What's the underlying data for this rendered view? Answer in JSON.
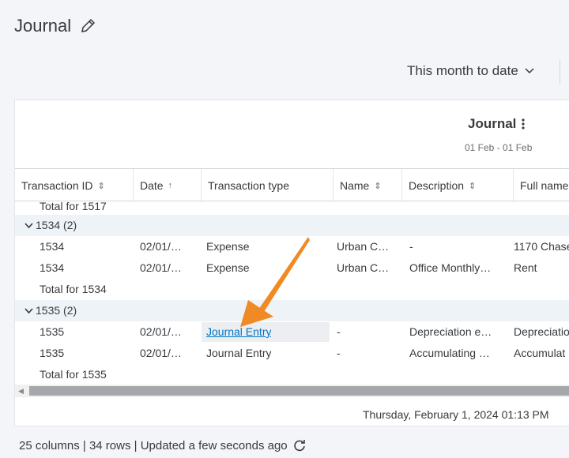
{
  "page": {
    "title": "Journal"
  },
  "filter": {
    "date_range": "This month to date"
  },
  "report": {
    "title": "Journal",
    "range": "01 Feb - 01 Feb",
    "columns": [
      "Transaction ID",
      "Date",
      "Transaction type",
      "Name",
      "Description",
      "Full name"
    ],
    "sort_icons": [
      "⇕",
      "↑",
      "",
      "⇕",
      "⇕",
      ""
    ],
    "rows": [
      {
        "kind": "total",
        "label": "Total for 1517"
      },
      {
        "kind": "group",
        "label": "1534 (2)"
      },
      {
        "kind": "data",
        "id": "1534",
        "date": "02/01/…",
        "type": "Expense",
        "name": "Urban C…",
        "desc": "-",
        "full": "1170 Chase"
      },
      {
        "kind": "data",
        "id": "1534",
        "date": "02/01/…",
        "type": "Expense",
        "name": "Urban C…",
        "desc": "Office Monthly…",
        "full": "Rent"
      },
      {
        "kind": "total",
        "label": "Total for 1534"
      },
      {
        "kind": "group",
        "label": "1535 (2)"
      },
      {
        "kind": "data",
        "id": "1535",
        "date": "02/01/…",
        "type": "Journal Entry",
        "name": "-",
        "desc": "Depreciation e…",
        "full": "Depreciatio"
      },
      {
        "kind": "data",
        "id": "1535",
        "date": "02/01/…",
        "type": "Journal Entry",
        "name": "-",
        "desc": "Accumulating …",
        "full": "Accumulat"
      },
      {
        "kind": "total",
        "label": "Total for 1535"
      }
    ],
    "footer_timestamp": "Thursday, February 1, 2024 01:13 PM"
  },
  "status": {
    "text": "25 columns | 34 rows | Updated a few seconds ago"
  },
  "colors": {
    "link": "#0077c5",
    "arrow": "#f08a24",
    "group_bg": "#eef3f8"
  }
}
